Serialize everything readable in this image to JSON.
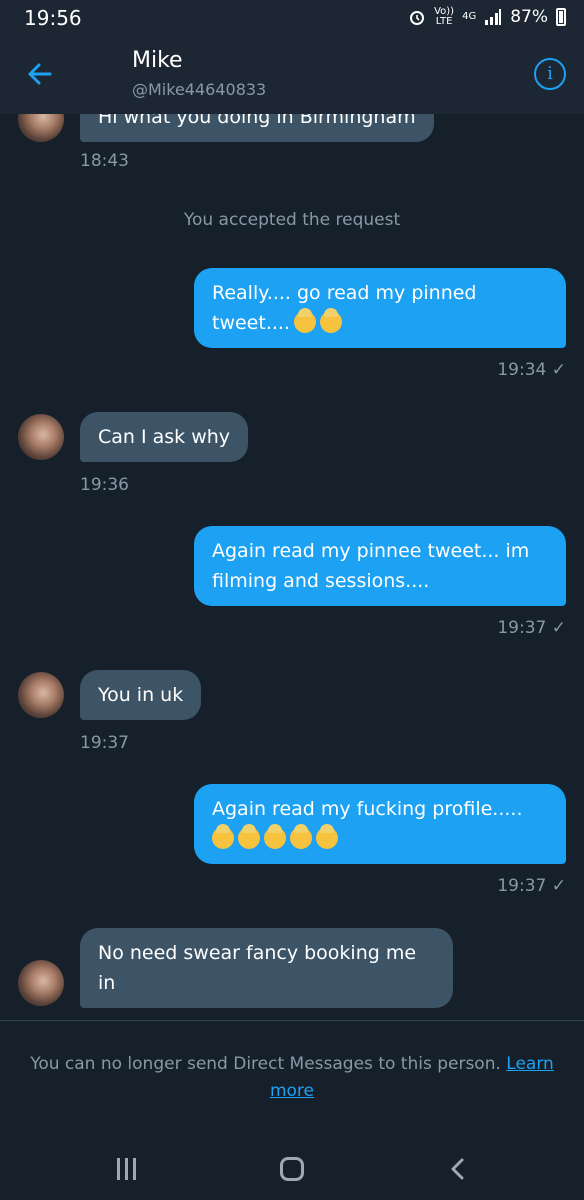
{
  "status_bar": {
    "time": "19:56",
    "volte_top": "Vo))",
    "volte_bottom": "LTE",
    "network": "4G",
    "battery": "87%"
  },
  "header": {
    "name": "Mike",
    "handle": "@Mike44640833"
  },
  "colors": {
    "background": "#15202b",
    "accent": "#1da1f2",
    "incoming_bubble": "#3d5466",
    "outgoing_bubble": "#1da1f2",
    "secondary_text": "#8899a6"
  },
  "icons": {
    "back": "arrow-left-icon",
    "info": "info-circle-icon",
    "emoji": "person-facepalming-emoji",
    "read": "check-icon",
    "nav": [
      "recents-icon",
      "home-icon",
      "back-chevron-icon"
    ]
  },
  "messages": [
    {
      "direction": "in",
      "text": "Hi what you doing in Birmingham",
      "time": "18:43"
    },
    {
      "direction": "system",
      "text": "You accepted the request"
    },
    {
      "direction": "out",
      "line1": "Really.... go read my pinned",
      "line2": "tweet....",
      "emoji_count": 2,
      "time": "19:34 ✓"
    },
    {
      "direction": "in",
      "text": "Can I ask why",
      "time": "19:36"
    },
    {
      "direction": "out",
      "line1": "Again read my pinnee tweet... im",
      "line2": "filming and sessions....",
      "time": "19:37 ✓"
    },
    {
      "direction": "in",
      "text": "You in uk",
      "time": "19:37"
    },
    {
      "direction": "out",
      "line1": "Again read my fucking profile.....",
      "emoji_count": 5,
      "time": "19:37 ✓"
    },
    {
      "direction": "in",
      "line1": "No need swear fancy booking me",
      "line2": "in"
    }
  ],
  "footer": {
    "notice": "You can no longer send Direct Messages to this person.",
    "link": "Learn more"
  }
}
